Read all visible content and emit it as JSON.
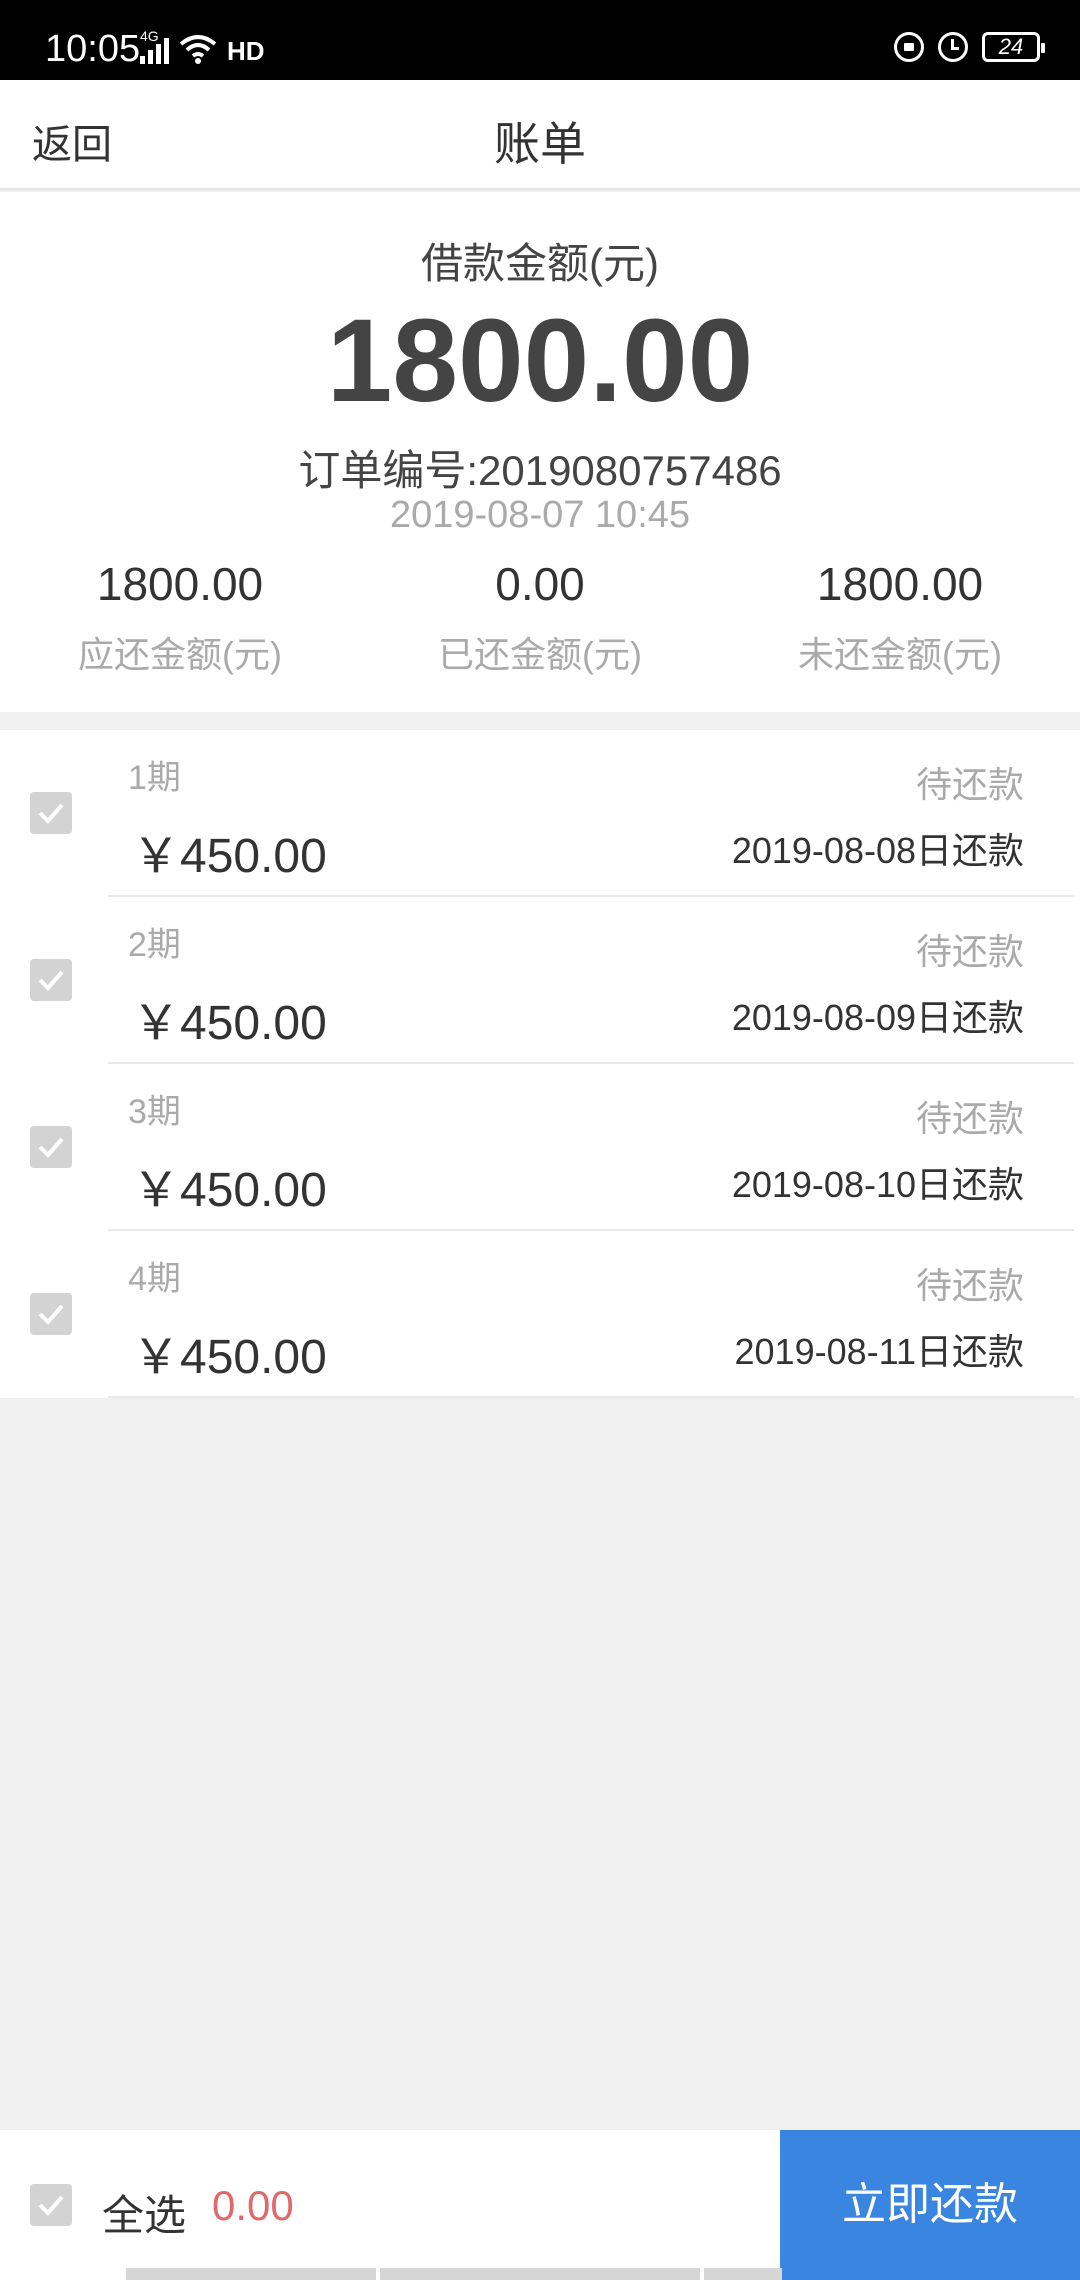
{
  "status_bar": {
    "time": "10:05",
    "network": "4G",
    "hd": "HD",
    "battery": "24"
  },
  "header": {
    "back_label": "返回",
    "title": "账单"
  },
  "summary": {
    "loan_label": "借款金额(元)",
    "loan_amount": "1800.00",
    "order_no": "订单编号:2019080757486",
    "order_date": "2019-08-07 10:45",
    "stats": [
      {
        "value": "1800.00",
        "label": "应还金额(元)"
      },
      {
        "value": "0.00",
        "label": "已还金额(元)"
      },
      {
        "value": "1800.00",
        "label": "未还金额(元)"
      }
    ]
  },
  "installments": [
    {
      "period": "1期",
      "amount": "￥450.00",
      "status": "待还款",
      "due": "2019-08-08日还款",
      "checked": true
    },
    {
      "period": "2期",
      "amount": "￥450.00",
      "status": "待还款",
      "due": "2019-08-09日还款",
      "checked": true
    },
    {
      "period": "3期",
      "amount": "￥450.00",
      "status": "待还款",
      "due": "2019-08-10日还款",
      "checked": true
    },
    {
      "period": "4期",
      "amount": "￥450.00",
      "status": "待还款",
      "due": "2019-08-11日还款",
      "checked": true
    }
  ],
  "footer": {
    "select_all_label": "全选",
    "total": "0.00",
    "pay_label": "立即还款"
  },
  "colors": {
    "accent": "#3a85e0",
    "total_red": "#e06a6a",
    "checkbox": "#d3d3d3"
  }
}
